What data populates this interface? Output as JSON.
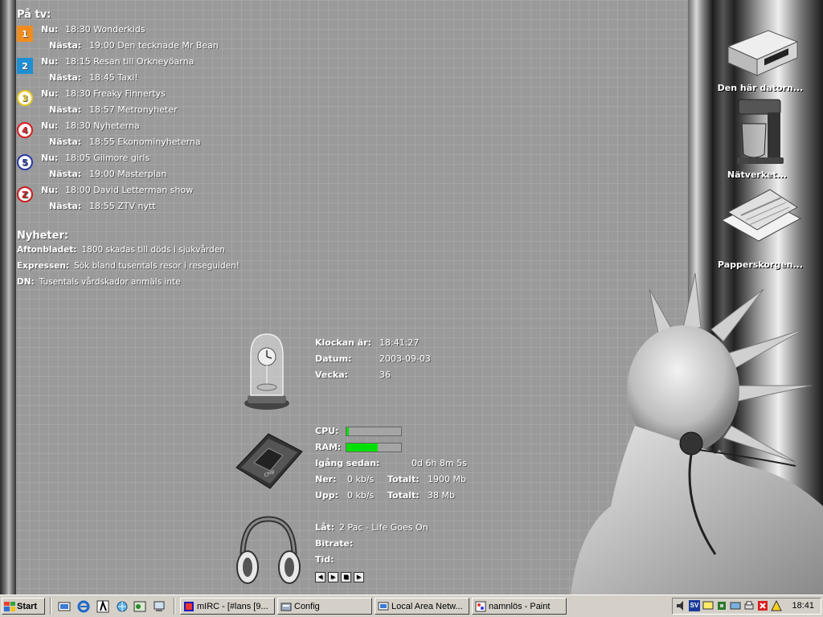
{
  "tv": {
    "title": "På tv:",
    "channels": [
      {
        "logo": "1",
        "logo_color": "#f08c1e",
        "now_label": "Nu:",
        "now": "18:30 Wonderkids",
        "next_label": "Nästa:",
        "next": "19:00 Den tecknade Mr Bean"
      },
      {
        "logo": "2",
        "logo_color": "#1e8fd2",
        "now_label": "Nu:",
        "now": "18:15 Resan till Orkneyöarna",
        "next_label": "Nästa:",
        "next": "18:45 Taxi!"
      },
      {
        "logo": "3",
        "logo_color": "#e6c81e",
        "now_label": "Nu:",
        "now": "18:30 Freaky Finnertys",
        "next_label": "Nästa:",
        "next": "18:57 Metronyheter"
      },
      {
        "logo": "4",
        "logo_color": "#d81e1e",
        "now_label": "Nu:",
        "now": "18:30 Nyheterna",
        "next_label": "Nästa:",
        "next": "18:55 Ekonominyheterna"
      },
      {
        "logo": "5",
        "logo_color": "#2a3aa8",
        "now_label": "Nu:",
        "now": "18:05 Gilmore girls",
        "next_label": "Nästa:",
        "next": "19:00 Masterplan"
      },
      {
        "logo": "Z",
        "logo_color": "#c81e1e",
        "now_label": "Nu:",
        "now": "18:00 David Letterman show",
        "next_label": "Nästa:",
        "next": "18:55 ZTV nytt"
      }
    ]
  },
  "news": {
    "title": "Nyheter:",
    "items": [
      {
        "source": "Aftonbladet:",
        "headline": "1800 skadas till döds i sjukvården"
      },
      {
        "source": "Expressen:",
        "headline": "Sök bland tusentals resor i reseguiden!"
      },
      {
        "source": "DN:",
        "headline": "Tusentals vårdskador anmäls inte"
      }
    ]
  },
  "clock": {
    "time_label": "Klockan är:",
    "time": "18:41:27",
    "date_label": "Datum:",
    "date": "2003-09-03",
    "week_label": "Vecka:",
    "week": "36"
  },
  "system": {
    "cpu_label": "CPU:",
    "cpu_percent": 5,
    "ram_label": "RAM:",
    "ram_percent": 58,
    "uptime_label": "Igång sedan:",
    "uptime": "0d 6h 8m 5s",
    "down_label": "Ner:",
    "down": "0 kb/s",
    "down_total_label": "Totalt:",
    "down_total": "1900 Mb",
    "up_label": "Upp:",
    "up": "0 kb/s",
    "up_total_label": "Totalt:",
    "up_total": "38 Mb"
  },
  "media": {
    "song_label": "Låt:",
    "song": "2 Pac - Life Goes On",
    "bitrate_label": "Bitrate:",
    "bitrate": "",
    "time_label": "Tid:",
    "time": ""
  },
  "desktop_icons": [
    {
      "label": "Den här datorn...",
      "icon": "computer-icon"
    },
    {
      "label": "Nätverket...",
      "icon": "network-icon"
    },
    {
      "label": "Papperskorgen...",
      "icon": "recycle-bin-icon"
    }
  ],
  "taskbar": {
    "start_label": "Start",
    "tasks": [
      {
        "label": "mIRC - [#lans [9...",
        "icon": "mirc-icon"
      },
      {
        "label": "Config",
        "icon": "config-icon"
      },
      {
        "label": "Local Area Netw...",
        "icon": "network-connection-icon"
      },
      {
        "label": "namnlös - Paint",
        "icon": "paint-icon"
      }
    ],
    "tray_lang": "SV",
    "clock": "18:41"
  }
}
